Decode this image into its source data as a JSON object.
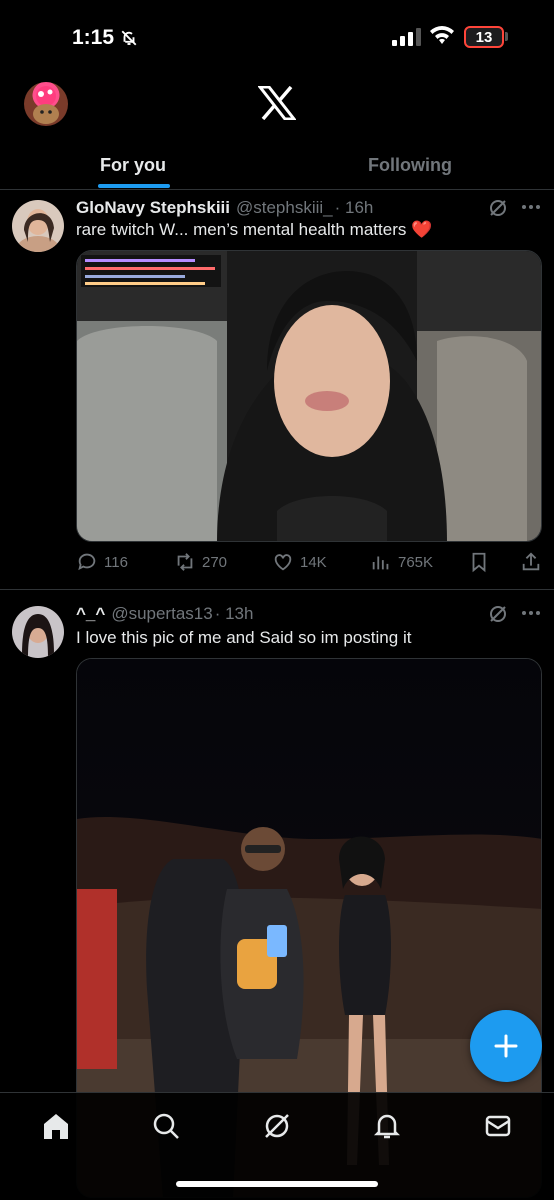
{
  "status_bar": {
    "time": "1:15",
    "battery": "13"
  },
  "tabs": [
    {
      "label": "For you",
      "active": true
    },
    {
      "label": "Following",
      "active": false
    }
  ],
  "tweets": [
    {
      "name": "GloNavy Stephskiii",
      "handle": "@stephskiii_",
      "time": "· 16h",
      "text": "rare twitch W... men’s mental health matters ❤️",
      "stats": {
        "replies": "116",
        "reposts": "270",
        "likes": "14K",
        "views": "765K"
      }
    },
    {
      "name": "^_^",
      "handle": "@supertas13",
      "time": "· 13h",
      "text": "I love this pic of me and Said so im posting it"
    }
  ],
  "icons": {
    "status": [
      "bell-off-icon",
      "signal-icon",
      "wifi-icon",
      "battery-icon"
    ],
    "header": [
      "avatar",
      "x-logo-icon"
    ],
    "tweet": [
      "grok-icon",
      "more-icon",
      "reply-icon",
      "repost-icon",
      "like-icon",
      "views-icon",
      "bookmark-icon",
      "share-icon"
    ],
    "nav": [
      "home-icon",
      "search-icon",
      "grok-icon",
      "notifications-icon",
      "messages-icon"
    ],
    "fab": "plus-icon"
  },
  "colors": {
    "accent": "#1d9bf0",
    "heart": "#f91880",
    "battery_low": "#ff453a"
  }
}
